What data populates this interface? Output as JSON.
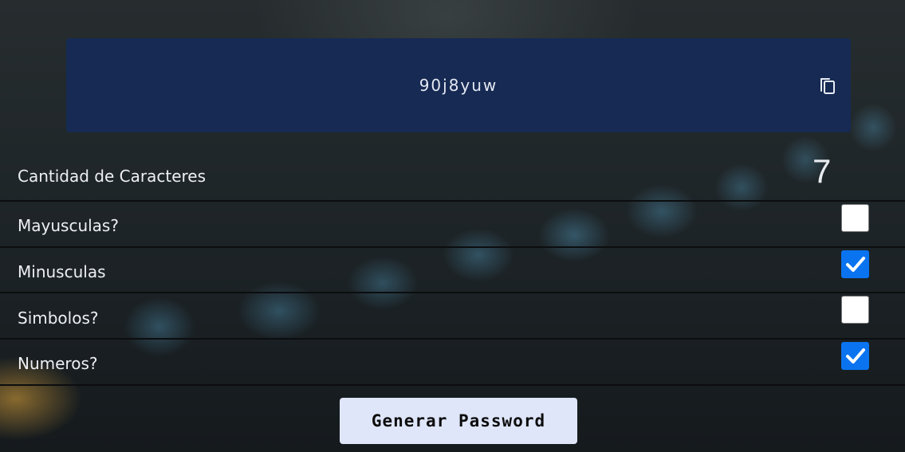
{
  "password": {
    "value": "90j8yuw",
    "copy_icon": "copy-icon"
  },
  "length": {
    "label": "Cantidad de Caracteres",
    "value": "7"
  },
  "options": [
    {
      "label": "Mayusculas?",
      "checked": false
    },
    {
      "label": "Minusculas",
      "checked": true
    },
    {
      "label": "Simbolos?",
      "checked": false
    },
    {
      "label": "Numeros?",
      "checked": true
    }
  ],
  "generate_button": {
    "label": "Generar Password"
  },
  "colors": {
    "password_box": "#162a53",
    "checkbox_checked": "#0a74f0",
    "button_bg": "#dfe6fa"
  }
}
